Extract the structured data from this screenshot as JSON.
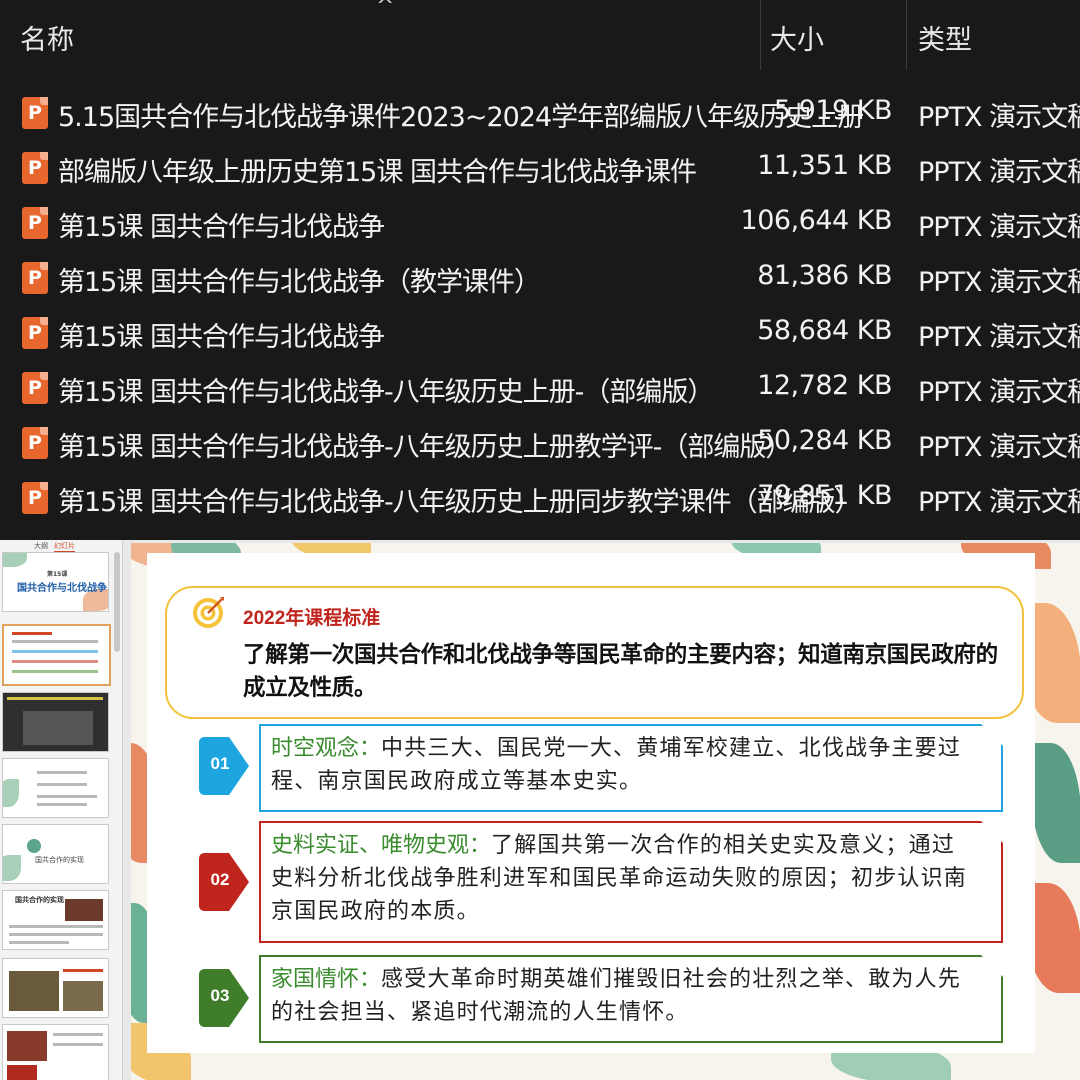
{
  "explorer": {
    "columns": {
      "name": "名称",
      "size": "大小",
      "type": "类型"
    },
    "sort_indicator": "^",
    "file_icon_letter": "P",
    "files": [
      {
        "name": "5.15国共合作与北伐战争课件2023~2024学年部编版八年级历史上册",
        "size": "5,919 KB",
        "type": "PPTX 演示文稿"
      },
      {
        "name": "部编版八年级上册历史第15课 国共合作与北伐战争课件",
        "size": "11,351 KB",
        "type": "PPTX 演示文稿"
      },
      {
        "name": "第15课  国共合作与北伐战争",
        "size": "106,644 KB",
        "type": "PPTX 演示文稿"
      },
      {
        "name": "第15课 国共合作与北伐战争（教学课件）",
        "size": "81,386 KB",
        "type": "PPTX 演示文稿"
      },
      {
        "name": "第15课 国共合作与北伐战争",
        "size": "58,684 KB",
        "type": "PPTX 演示文稿"
      },
      {
        "name": "第15课 国共合作与北伐战争-八年级历史上册-（部编版）",
        "size": "12,782 KB",
        "type": "PPTX 演示文稿"
      },
      {
        "name": "第15课 国共合作与北伐战争-八年级历史上册教学评-（部编版）",
        "size": "50,284 KB",
        "type": "PPTX 演示文稿"
      },
      {
        "name": "第15课 国共合作与北伐战争-八年级历史上册同步教学课件（部编版）",
        "size": "79,851 KB",
        "type": "PPTX 演示文稿"
      }
    ]
  },
  "ppt": {
    "tabs": {
      "outline": "大纲",
      "slides": "幻灯片"
    },
    "thumbnails": {
      "t1_title": "国共合作与北伐战争",
      "t1_lesson": "第15课",
      "t5_text": "国共合作的实现",
      "t6_title": "国共合作的实现"
    },
    "slide": {
      "standard_title": "2022年课程标准",
      "standard_text": "了解第一次国共合作和北伐战争等国民革命的主要内容；知道南京国民政府的成立及性质。",
      "items": [
        {
          "num": "01",
          "head": "时空观念：",
          "text": "中共三大、国民党一大、黄埔军校建立、北伐战争主要过程、南京国民政府成立等基本史实。",
          "color": "#1ea5e0",
          "head_color": "#3a8c2f"
        },
        {
          "num": "02",
          "head": "史料实证、唯物史观：",
          "text": "了解国共第一次合作的相关史实及意义；通过史料分析北伐战争胜利进军和国民革命运动失败的原因；初步认识南京国民政府的本质。",
          "color": "#c0251d",
          "head_color": "#3a8c2f"
        },
        {
          "num": "03",
          "head": "家国情怀：",
          "text": "感受大革命时期英雄们摧毁旧社会的壮烈之举、敢为人先的社会担当、紧追时代潮流的人生情怀。",
          "color": "#3f7d2b",
          "head_color": "#3a8c2f"
        }
      ]
    }
  }
}
